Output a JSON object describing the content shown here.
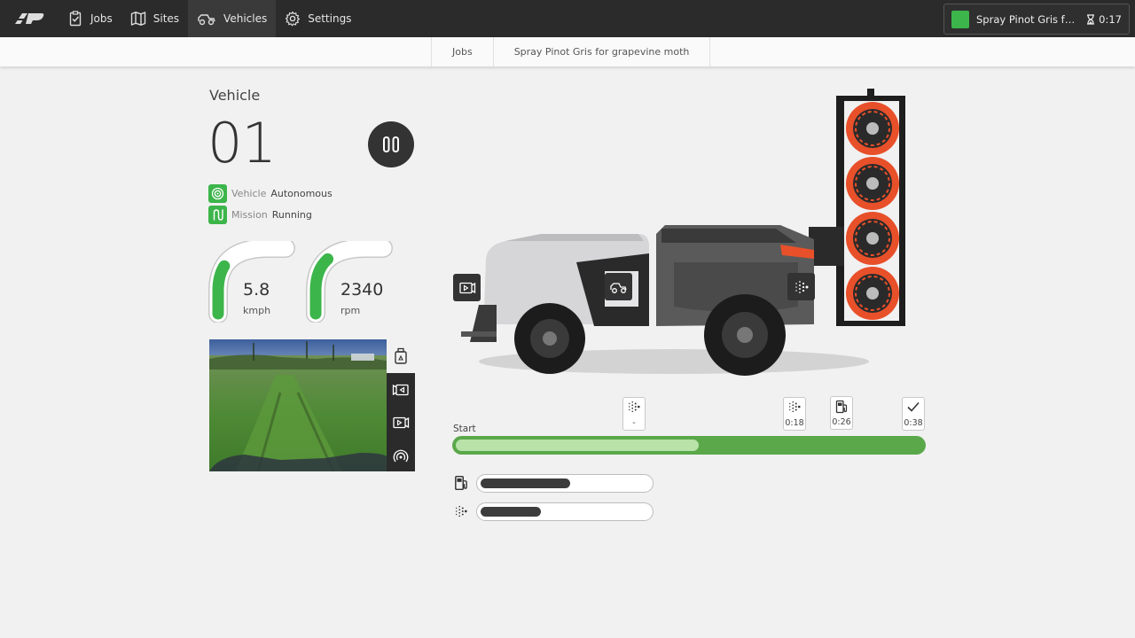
{
  "nav": {
    "items": [
      {
        "label": "Jobs",
        "icon": "clipboard-check-icon"
      },
      {
        "label": "Sites",
        "icon": "map-icon"
      },
      {
        "label": "Vehicles",
        "icon": "vehicle-icon",
        "active": true
      },
      {
        "label": "Settings",
        "icon": "gear-icon"
      }
    ],
    "current_job": {
      "name": "Spray Pinot Gris for grapevine moth",
      "timer": "0:17",
      "status_color": "#3cb54a"
    }
  },
  "breadcrumb": [
    "Jobs",
    "Spray Pinot Gris for grapevine moth"
  ],
  "vehicle": {
    "heading": "Vehicle",
    "number": "01",
    "status": [
      {
        "label": "Vehicle",
        "value": "Autonomous",
        "icon": "target-icon"
      },
      {
        "label": "Mission",
        "value": "Running",
        "icon": "route-icon"
      }
    ],
    "gauges": [
      {
        "value": "5.8",
        "unit": "kmph",
        "fraction": 0.42
      },
      {
        "value": "2340",
        "unit": "rpm",
        "fraction": 0.5
      }
    ]
  },
  "timeline": {
    "start_label": "Start",
    "progress_fraction": 0.52,
    "markers": [
      {
        "icon": "spray-icon",
        "label": "-"
      },
      {
        "icon": "spray-icon",
        "label": "0:18"
      },
      {
        "icon": "fuel-icon",
        "label": "0:26"
      },
      {
        "icon": "check-icon",
        "label": "0:38"
      }
    ]
  },
  "levels": [
    {
      "icon": "fuel-icon",
      "fraction": 0.53
    },
    {
      "icon": "spray-icon",
      "fraction": 0.36
    }
  ],
  "colors": {
    "accent": "#3cb54a",
    "dark": "#2b2b2b",
    "progress": "#5aa84a",
    "progress_light": "#b8e2a8",
    "fan": "#e8502a"
  }
}
